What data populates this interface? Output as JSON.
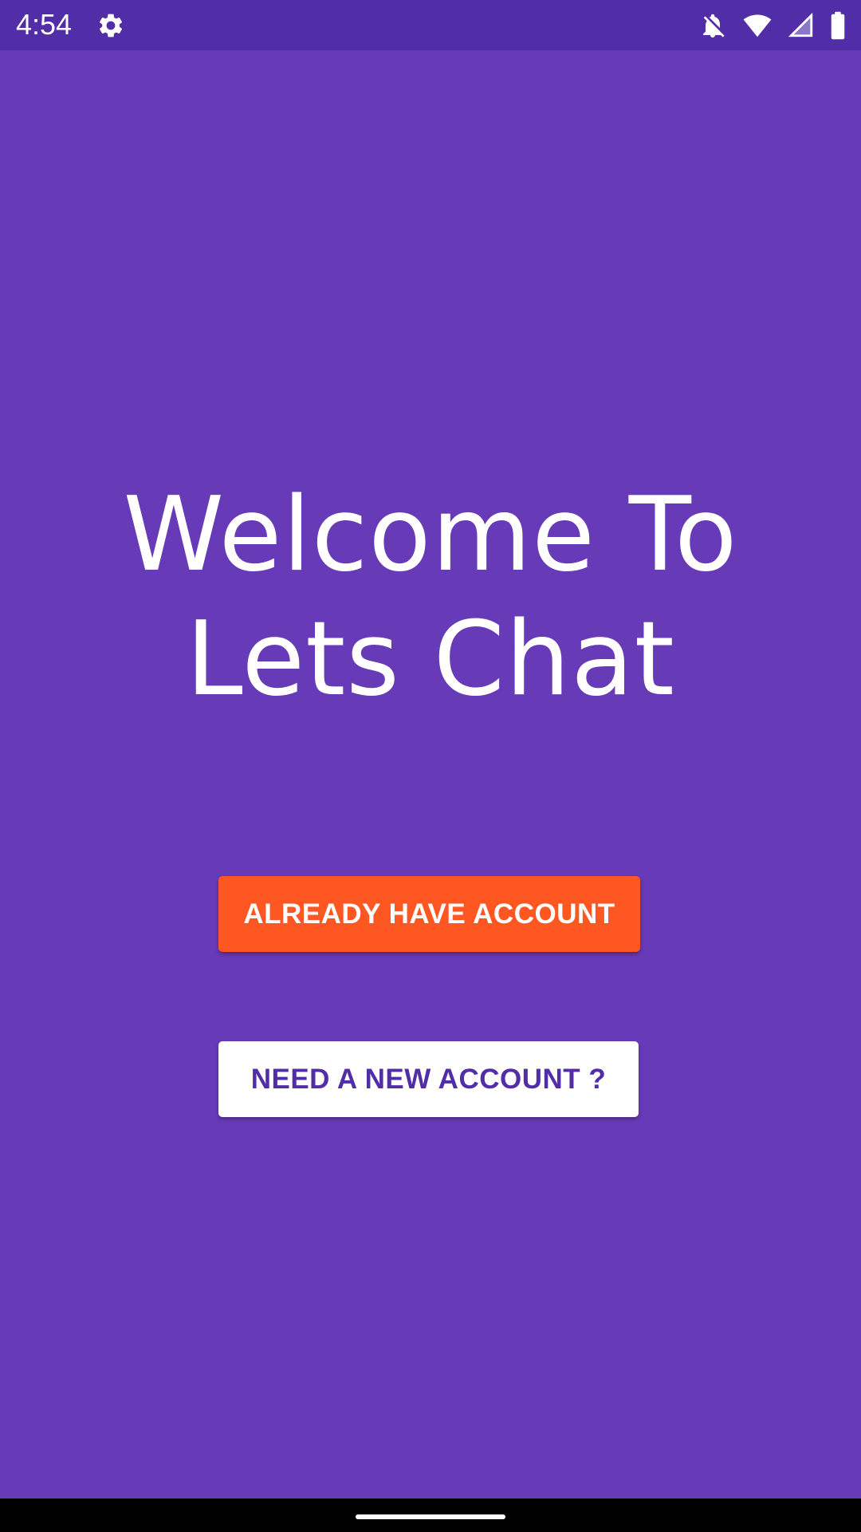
{
  "status_bar": {
    "time": "4:54",
    "icons": [
      "settings-gear-icon",
      "notifications-off-icon",
      "wifi-icon",
      "cellular-signal-icon",
      "battery-icon"
    ],
    "background": "#512DA8"
  },
  "main": {
    "title_line1": "Welcome To",
    "title_line2": "Lets Chat",
    "background": "#673AB7",
    "login_button_label": "ALREADY HAVE ACCOUNT",
    "login_button_color": "#FF5722",
    "register_button_label": "NEED A NEW ACCOUNT ?",
    "register_button_color": "#FFFFFF",
    "register_button_text_color": "#512DA8"
  },
  "nav_bar": {
    "icons": [
      "home-gesture-handle"
    ]
  }
}
